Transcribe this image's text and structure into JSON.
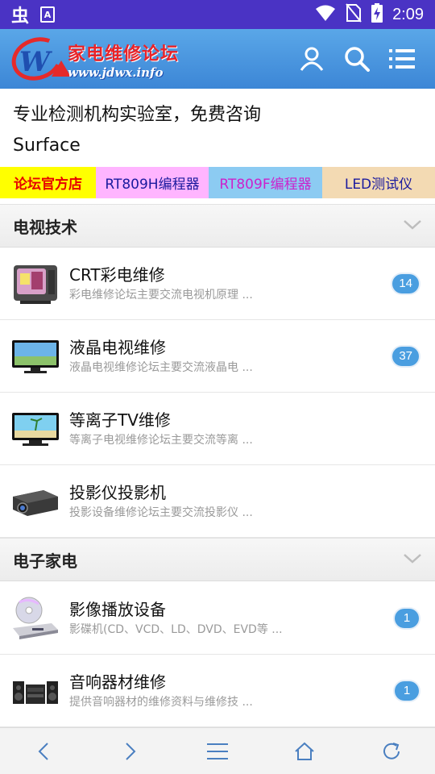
{
  "status_bar": {
    "app_icon": "虫",
    "notif_icon": "A",
    "time": "2:09",
    "icons": [
      "wifi-icon",
      "no-sim-icon",
      "battery-charging-icon"
    ]
  },
  "header": {
    "logo_title": "家电维修论坛",
    "logo_url": "www.jdwx.info",
    "icons": [
      "user-icon",
      "search-icon",
      "menu-icon"
    ]
  },
  "ad": {
    "line1": "专业检测机构实验室，免费咨询",
    "line2": "Surface"
  },
  "quicklinks": [
    {
      "label": "论坛官方店",
      "color": "#e60000",
      "bg": "#ffff00"
    },
    {
      "label": "RT809H编程器",
      "color": "#1a1a9e",
      "bg": "#ffb5ff"
    },
    {
      "label": "RT809F编程器",
      "color": "#cc22cc",
      "bg": "#8ccbf2"
    },
    {
      "label": "LED测试仪",
      "color": "#1a1a9e",
      "bg": "#f3dab3"
    }
  ],
  "sections": [
    {
      "title": "电视技术",
      "forums": [
        {
          "title": "CRT彩电维修",
          "desc": "彩电维修论坛主要交流电视机原理 ...",
          "count": "14",
          "icon": "crt-tv-icon"
        },
        {
          "title": "液晶电视维修",
          "desc": "液晶电视维修论坛主要交流液晶电 ...",
          "count": "37",
          "icon": "lcd-tv-icon"
        },
        {
          "title": "等离子TV维修",
          "desc": "等离子电视维修论坛主要交流等离 ...",
          "count": "",
          "icon": "plasma-tv-icon"
        },
        {
          "title": "投影仪投影机",
          "desc": "投影设备维修论坛主要交流投影仪 ...",
          "count": "",
          "icon": "projector-icon"
        }
      ]
    },
    {
      "title": "电子家电",
      "forums": [
        {
          "title": "影像播放设备",
          "desc": "影碟机(CD、VCD、LD、DVD、EVD等 ...",
          "count": "1",
          "icon": "disc-player-icon"
        },
        {
          "title": "音响器材维修",
          "desc": "提供音响器材的维修资料与维修技 ...",
          "count": "1",
          "icon": "stereo-icon"
        }
      ]
    }
  ],
  "bottom_nav": [
    "back-icon",
    "forward-icon",
    "menu-icon",
    "home-icon",
    "refresh-icon"
  ],
  "colors": {
    "status_bar": "#4a33c4",
    "header": "#4a95e0",
    "badge": "#4a9ee0"
  }
}
